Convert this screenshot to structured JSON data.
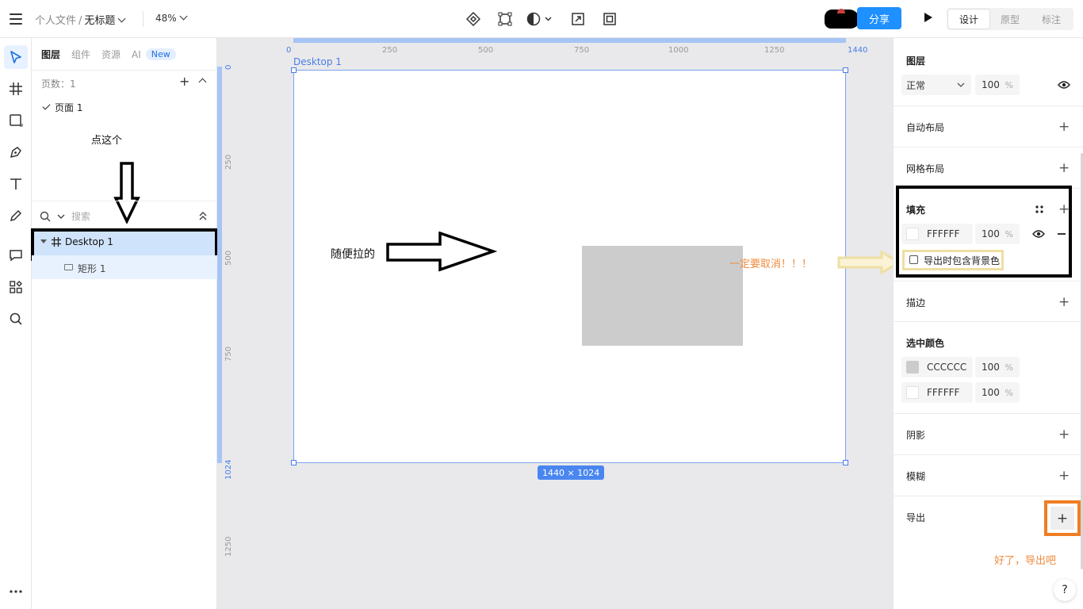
{
  "topbar": {
    "breadcrumb_folder": "个人文件",
    "breadcrumb_sep": "/",
    "breadcrumb_file": "无标题",
    "zoom": "48%",
    "share_label": "分享",
    "mode_tabs": [
      "设计",
      "原型",
      "标注"
    ],
    "active_mode": "设计"
  },
  "layers_panel": {
    "tabs": [
      "图层",
      "组件",
      "资源",
      "AI"
    ],
    "new_badge": "New",
    "pages_label": "页数：1",
    "page_name": "页面 1",
    "search_placeholder": "搜索",
    "layers": [
      {
        "name": "Desktop 1",
        "type": "frame"
      },
      {
        "name": "矩形 1",
        "type": "rectangle"
      }
    ]
  },
  "canvas": {
    "frame_name": "Desktop 1",
    "size_badge": "1440 × 1024",
    "ruler_top": [
      "0",
      "250",
      "500",
      "750",
      "1000",
      "1250",
      "1440"
    ],
    "ruler_left": [
      "0",
      "250",
      "500",
      "750",
      "1024",
      "1250"
    ],
    "rect_fill": "#CCCCCC"
  },
  "right_panel": {
    "layer_title": "图层",
    "blend_mode": "正常",
    "layer_opacity": "100",
    "pct": "%",
    "auto_layout": "自动布局",
    "grid_layout": "网格布局",
    "fill_title": "填充",
    "fill_hex": "FFFFFF",
    "fill_opacity": "100",
    "export_bg_label": "导出时包含背景色",
    "stroke": "描边",
    "selection_colors_title": "选中颜色",
    "selection_colors": [
      {
        "hex": "CCCCCC",
        "opacity": "100",
        "color": "#cccccc"
      },
      {
        "hex": "FFFFFF",
        "opacity": "100",
        "color": "#ffffff"
      }
    ],
    "shadow": "阴影",
    "blur": "模糊",
    "export": "导出",
    "help": "?"
  },
  "annotations": {
    "click_this": "点这个",
    "drag_anything": "随便拉的",
    "must_uncheck": "一定要取消！！！",
    "export_now": "好了，导出吧"
  },
  "colors": {
    "accent": "#1e90ff",
    "selection": "#4a7de8",
    "annotation_orange": "#f08a3c"
  }
}
